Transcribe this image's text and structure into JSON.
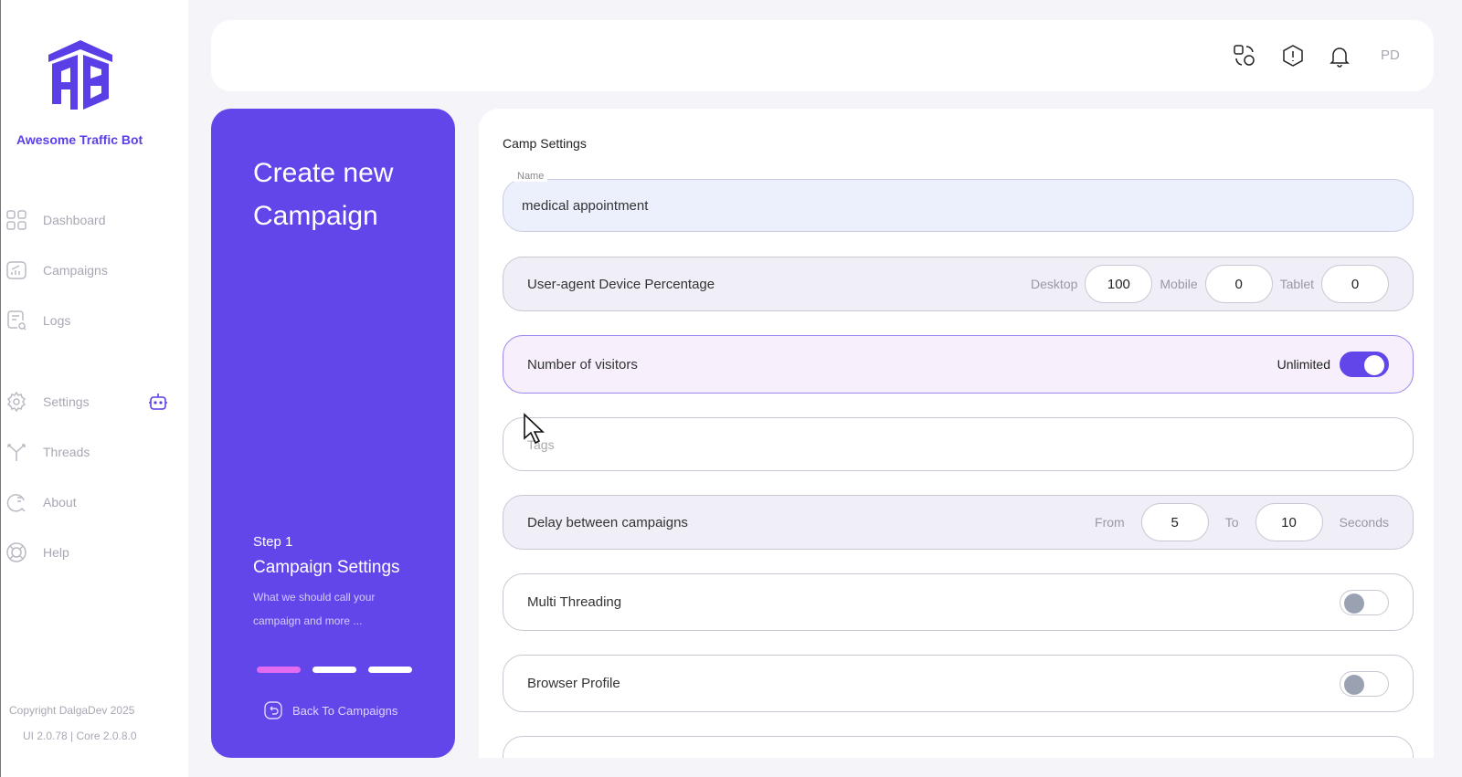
{
  "brand": {
    "name": "Awesome Traffic Bot",
    "logo_text": "ATB"
  },
  "nav": [
    {
      "label": "Dashboard"
    },
    {
      "label": "Campaigns"
    },
    {
      "label": "Logs"
    },
    {
      "label": "Settings"
    },
    {
      "label": "Threads"
    },
    {
      "label": "About"
    },
    {
      "label": "Help"
    }
  ],
  "footer": {
    "copyright": "Copyright DalgaDev 2025",
    "version": "UI 2.0.78 | Core 2.0.8.0"
  },
  "header": {
    "user_initials": "PD"
  },
  "panel": {
    "title": "Create new Campaign",
    "step": "Step 1",
    "step_title": "Campaign Settings",
    "step_desc": "What we should call your campaign and more ...",
    "current_step": 1,
    "total_steps": 3,
    "back_label": "Back To Campaigns"
  },
  "form": {
    "title": "Camp Settings",
    "name": {
      "label": "Name",
      "value": "medical appointment"
    },
    "device": {
      "label": "User-agent Device Percentage",
      "desktop_label": "Desktop",
      "desktop": "100",
      "mobile_label": "Mobile",
      "mobile": "0",
      "tablet_label": "Tablet",
      "tablet": "0"
    },
    "visitors": {
      "label": "Number of visitors",
      "unlimited_label": "Unlimited",
      "unlimited": true
    },
    "tags": {
      "placeholder": "Tags"
    },
    "delay": {
      "label": "Delay between campaigns",
      "from_label": "From",
      "from": "5",
      "to_label": "To",
      "to": "10",
      "unit": "Seconds"
    },
    "multi_threading": {
      "label": "Multi Threading",
      "enabled": false
    },
    "browser_profile": {
      "label": "Browser Profile",
      "enabled": false
    }
  }
}
